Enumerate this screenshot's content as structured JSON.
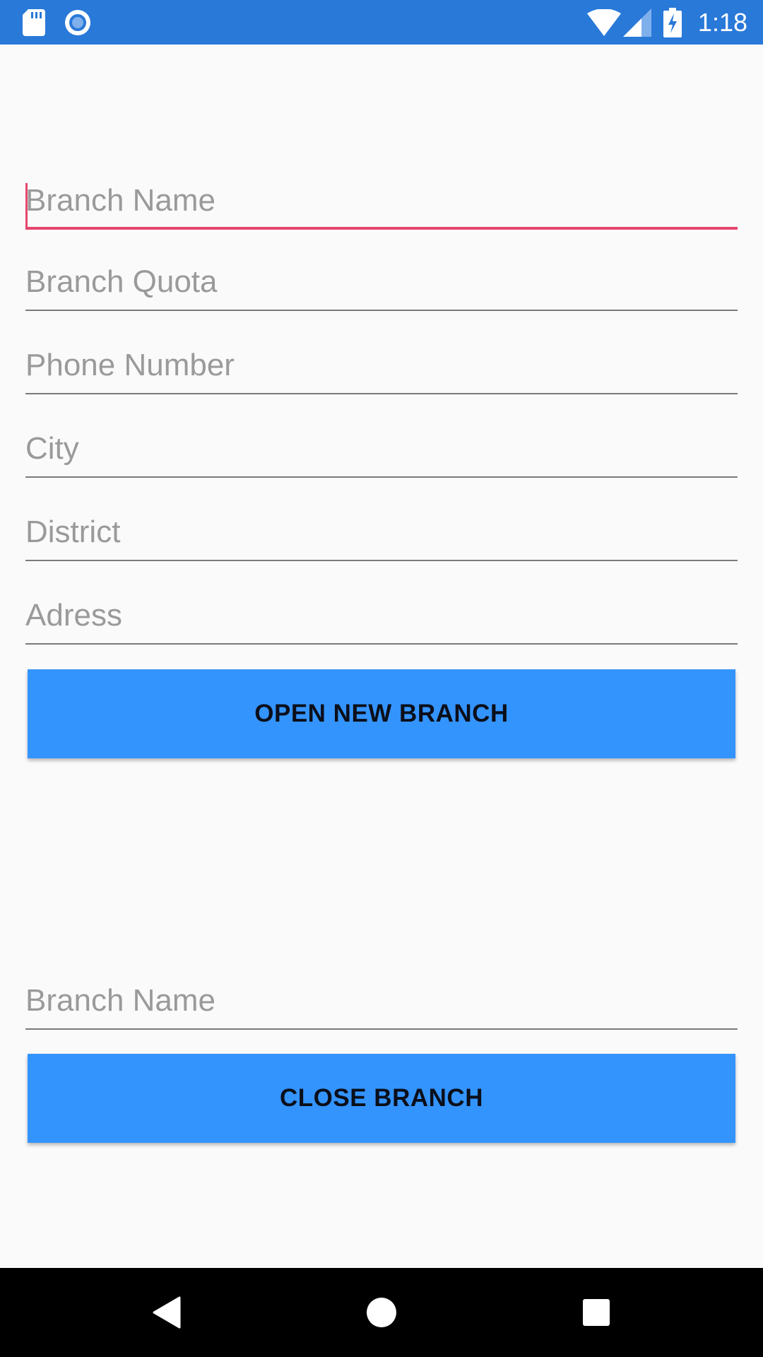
{
  "status_bar": {
    "time": "1:18",
    "icons": [
      "sd-card-icon",
      "sync-icon",
      "wifi-icon",
      "signal-icon",
      "battery-charging-icon"
    ]
  },
  "form": {
    "open_branch": {
      "fields": [
        {
          "name": "branch-name",
          "placeholder": "Branch Name",
          "value": ""
        },
        {
          "name": "branch-quota",
          "placeholder": "Branch Quota",
          "value": ""
        },
        {
          "name": "phone-number",
          "placeholder": "Phone Number",
          "value": ""
        },
        {
          "name": "city",
          "placeholder": "City",
          "value": ""
        },
        {
          "name": "district",
          "placeholder": "District",
          "value": ""
        },
        {
          "name": "adress",
          "placeholder": "Adress",
          "value": ""
        }
      ],
      "button_label": "OPEN NEW BRANCH"
    },
    "close_branch": {
      "field": {
        "name": "close-branch-name",
        "placeholder": "Branch Name",
        "value": ""
      },
      "button_label": "CLOSE BRANCH"
    }
  },
  "colors": {
    "status_bar": "#2979d9",
    "accent_focus": "#e6466e",
    "button": "#3494fe",
    "background": "#fafafa",
    "nav_bar": "#000000"
  },
  "nav_bar": {
    "buttons": [
      "back-icon",
      "home-icon",
      "recents-icon"
    ]
  }
}
